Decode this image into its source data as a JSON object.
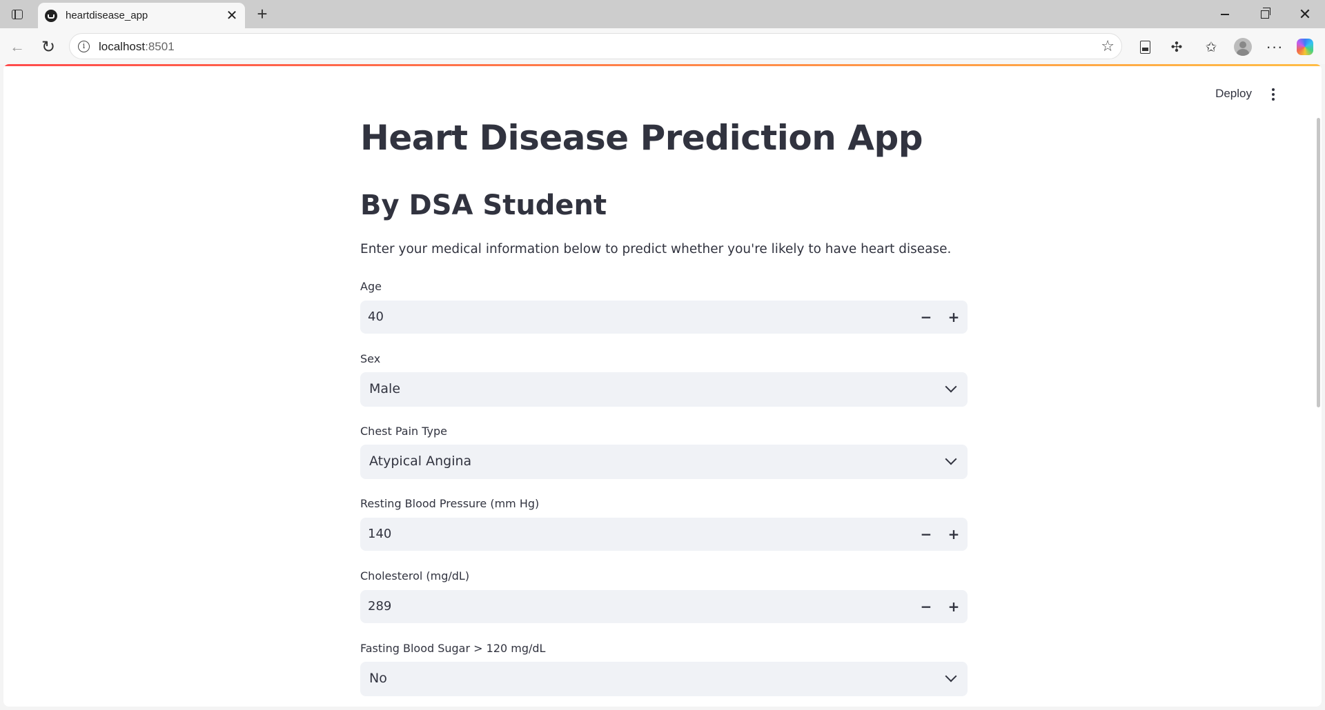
{
  "browser": {
    "tab_title": "heartdisease_app",
    "tab_close": "✕",
    "new_tab": "+",
    "url_host": "localhost",
    "url_port": ":8501",
    "more_label": "···"
  },
  "header": {
    "deploy_label": "Deploy"
  },
  "app": {
    "title": "Heart Disease Prediction App",
    "subtitle": "By DSA Student",
    "intro": "Enter your medical information below to predict whether you're likely to have heart disease."
  },
  "form": {
    "age": {
      "label": "Age",
      "value": "40"
    },
    "sex": {
      "label": "Sex",
      "value": "Male"
    },
    "chest_pain": {
      "label": "Chest Pain Type",
      "value": "Atypical Angina"
    },
    "resting_bp": {
      "label": "Resting Blood Pressure (mm Hg)",
      "value": "140"
    },
    "cholesterol": {
      "label": "Cholesterol (mg/dL)",
      "value": "289"
    },
    "fasting_bs": {
      "label": "Fasting Blood Sugar > 120 mg/dL",
      "value": "No"
    },
    "minus": "−",
    "plus": "+"
  },
  "colors": {
    "accent_start": "#ff4b4b",
    "accent_end": "#ffbd45",
    "input_bg": "#f0f2f6",
    "text": "#31333f"
  }
}
